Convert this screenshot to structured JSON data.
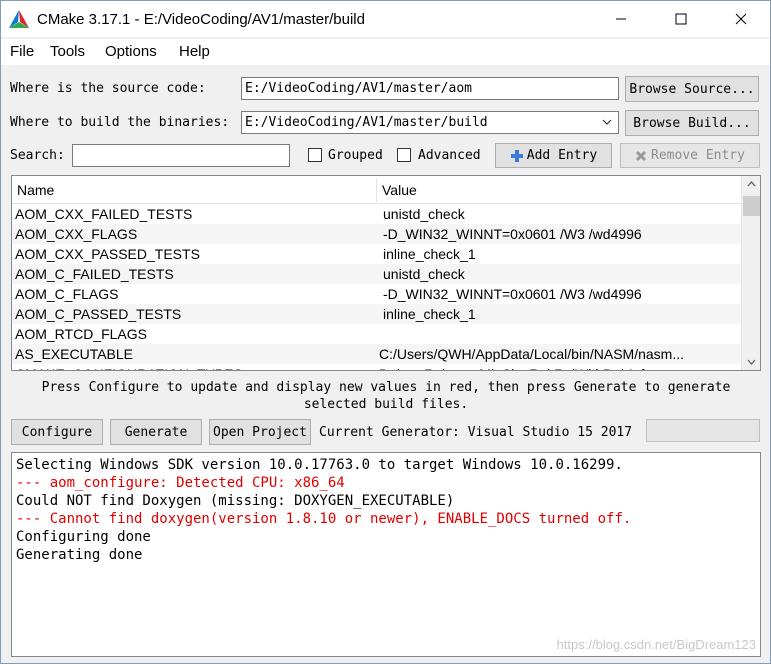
{
  "window": {
    "title": "CMake 3.17.1 - E:/VideoCoding/AV1/master/build",
    "minimize": "—",
    "maximize": "☐",
    "close": "✕"
  },
  "menu": [
    "File",
    "Tools",
    "Options",
    "Help"
  ],
  "source": {
    "label": "Where is the source code:",
    "value": "E:/VideoCoding/AV1/master/aom",
    "button": "Browse Source..."
  },
  "build": {
    "label": "Where to build the binaries:",
    "value": "E:/VideoCoding/AV1/master/build",
    "button": "Browse Build..."
  },
  "search": {
    "label": "Search:",
    "value": "",
    "grouped_label": "Grouped",
    "grouped_checked": false,
    "advanced_label": "Advanced",
    "advanced_checked": false,
    "add_entry": "Add Entry",
    "remove_entry": "Remove Entry"
  },
  "table": {
    "headers": {
      "name": "Name",
      "value": "Value"
    },
    "rows": [
      {
        "name": "AOM_CXX_FAILED_TESTS",
        "value": "unistd_check"
      },
      {
        "name": "AOM_CXX_FLAGS",
        "value": "-D_WIN32_WINNT=0x0601 /W3 /wd4996"
      },
      {
        "name": "AOM_CXX_PASSED_TESTS",
        "value": "inline_check_1"
      },
      {
        "name": "AOM_C_FAILED_TESTS",
        "value": "unistd_check"
      },
      {
        "name": "AOM_C_FLAGS",
        "value": "-D_WIN32_WINNT=0x0601 /W3 /wd4996"
      },
      {
        "name": "AOM_C_PASSED_TESTS",
        "value": "inline_check_1"
      },
      {
        "name": "AOM_RTCD_FLAGS",
        "value": ""
      },
      {
        "name": "AS_EXECUTABLE",
        "value": "C:/Users/QWH/AppData/Local/bin/NASM/nasm..."
      },
      {
        "name": "CMAKE_CONFIGURATION_TYPES",
        "value": "Debug;Release;MinSizeRel;RelWithDebInfo"
      }
    ]
  },
  "info_text": "Press Configure to update and display new values in red, then press Generate to generate selected build files.",
  "actions": {
    "configure": "Configure",
    "generate": "Generate",
    "open_project": "Open Project",
    "generator": "Current Generator: Visual Studio 15 2017"
  },
  "output": [
    {
      "text": "Selecting Windows SDK version 10.0.17763.0 to target Windows 10.0.16299.",
      "color": "#000000"
    },
    {
      "text": "--- aom_configure: Detected CPU: x86_64",
      "color": "#e00000"
    },
    {
      "text": "Could NOT find Doxygen (missing: DOXYGEN_EXECUTABLE)",
      "color": "#000000"
    },
    {
      "text": "--- Cannot find doxygen(version 1.8.10 or newer), ENABLE_DOCS turned off.",
      "color": "#e00000"
    },
    {
      "text": "Configuring done",
      "color": "#000000"
    },
    {
      "text": "Generating done",
      "color": "#000000"
    }
  ],
  "watermark": "https://blog.csdn.net/BigDream123"
}
